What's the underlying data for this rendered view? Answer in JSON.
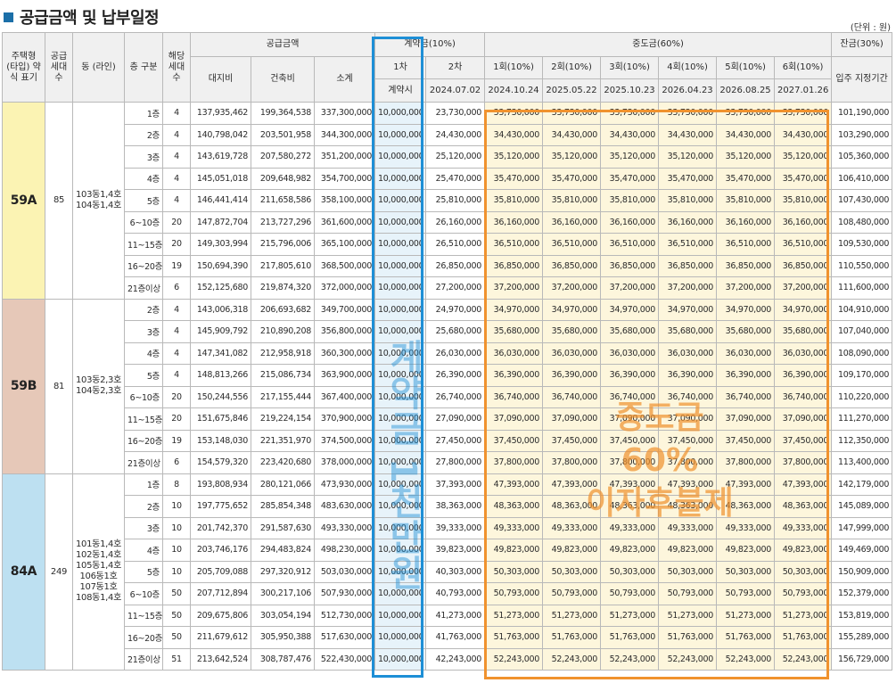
{
  "title": "공급금액 및 납부일정",
  "unit_note": "(단위 : 원)",
  "headers": {
    "type": "주택형 (타입) 약식 표기",
    "supply_units": "공급 세대 수",
    "dong": "동 (라인)",
    "floor": "층 구분",
    "households": "해당 세대 수",
    "supply_amount": "공급금액",
    "land": "대지비",
    "building": "건축비",
    "subtotal": "소계",
    "contract": "계약금(10%)",
    "first": "1차",
    "second": "2차",
    "contract_time": "계약시",
    "second_date": "2024.07.02",
    "middle": "중도금(60%)",
    "middle_items": [
      "1회(10%)",
      "2회(10%)",
      "3회(10%)",
      "4회(10%)",
      "5회(10%)",
      "6회(10%)"
    ],
    "middle_dates": [
      "2024.10.24",
      "2025.05.22",
      "2025.10.23",
      "2026.04.23",
      "2026.08.25",
      "2027.01.26"
    ],
    "balance": "잔금(30%)",
    "move_in": "입주 지정기간"
  },
  "watermarks": {
    "blue": "계약금 1천만원",
    "orange_line1": "중도금",
    "orange_line2": "60%",
    "orange_line3": "이자후불제"
  },
  "groups": [
    {
      "type": "59A",
      "supply_units": "85",
      "dong": "103동1,4호 104동1,4호",
      "rows": [
        {
          "floor": "1층",
          "hh": "4",
          "land": "137,935,462",
          "build": "199,364,538",
          "sub": "337,300,000",
          "c1": "10,000,000",
          "c2": "23,730,000",
          "m": "33,730,000",
          "bal": "101,190,000"
        },
        {
          "floor": "2층",
          "hh": "4",
          "land": "140,798,042",
          "build": "203,501,958",
          "sub": "344,300,000",
          "c1": "10,000,000",
          "c2": "24,430,000",
          "m": "34,430,000",
          "bal": "103,290,000"
        },
        {
          "floor": "3층",
          "hh": "4",
          "land": "143,619,728",
          "build": "207,580,272",
          "sub": "351,200,000",
          "c1": "10,000,000",
          "c2": "25,120,000",
          "m": "35,120,000",
          "bal": "105,360,000"
        },
        {
          "floor": "4층",
          "hh": "4",
          "land": "145,051,018",
          "build": "209,648,982",
          "sub": "354,700,000",
          "c1": "10,000,000",
          "c2": "25,470,000",
          "m": "35,470,000",
          "bal": "106,410,000"
        },
        {
          "floor": "5층",
          "hh": "4",
          "land": "146,441,414",
          "build": "211,658,586",
          "sub": "358,100,000",
          "c1": "10,000,000",
          "c2": "25,810,000",
          "m": "35,810,000",
          "bal": "107,430,000"
        },
        {
          "floor": "6~10층",
          "hh": "20",
          "land": "147,872,704",
          "build": "213,727,296",
          "sub": "361,600,000",
          "c1": "10,000,000",
          "c2": "26,160,000",
          "m": "36,160,000",
          "bal": "108,480,000"
        },
        {
          "floor": "11~15층",
          "hh": "20",
          "land": "149,303,994",
          "build": "215,796,006",
          "sub": "365,100,000",
          "c1": "10,000,000",
          "c2": "26,510,000",
          "m": "36,510,000",
          "bal": "109,530,000"
        },
        {
          "floor": "16~20층",
          "hh": "19",
          "land": "150,694,390",
          "build": "217,805,610",
          "sub": "368,500,000",
          "c1": "10,000,000",
          "c2": "26,850,000",
          "m": "36,850,000",
          "bal": "110,550,000"
        },
        {
          "floor": "21층이상",
          "hh": "6",
          "land": "152,125,680",
          "build": "219,874,320",
          "sub": "372,000,000",
          "c1": "10,000,000",
          "c2": "27,200,000",
          "m": "37,200,000",
          "bal": "111,600,000"
        }
      ]
    },
    {
      "type": "59B",
      "supply_units": "81",
      "dong": "103동2,3호 104동2,3호",
      "rows": [
        {
          "floor": "2층",
          "hh": "4",
          "land": "143,006,318",
          "build": "206,693,682",
          "sub": "349,700,000",
          "c1": "10,000,000",
          "c2": "24,970,000",
          "m": "34,970,000",
          "bal": "104,910,000"
        },
        {
          "floor": "3층",
          "hh": "4",
          "land": "145,909,792",
          "build": "210,890,208",
          "sub": "356,800,000",
          "c1": "10,000,000",
          "c2": "25,680,000",
          "m": "35,680,000",
          "bal": "107,040,000"
        },
        {
          "floor": "4층",
          "hh": "4",
          "land": "147,341,082",
          "build": "212,958,918",
          "sub": "360,300,000",
          "c1": "10,000,000",
          "c2": "26,030,000",
          "m": "36,030,000",
          "bal": "108,090,000"
        },
        {
          "floor": "5층",
          "hh": "4",
          "land": "148,813,266",
          "build": "215,086,734",
          "sub": "363,900,000",
          "c1": "10,000,000",
          "c2": "26,390,000",
          "m": "36,390,000",
          "bal": "109,170,000"
        },
        {
          "floor": "6~10층",
          "hh": "20",
          "land": "150,244,556",
          "build": "217,155,444",
          "sub": "367,400,000",
          "c1": "10,000,000",
          "c2": "26,740,000",
          "m": "36,740,000",
          "bal": "110,220,000"
        },
        {
          "floor": "11~15층",
          "hh": "20",
          "land": "151,675,846",
          "build": "219,224,154",
          "sub": "370,900,000",
          "c1": "10,000,000",
          "c2": "27,090,000",
          "m": "37,090,000",
          "bal": "111,270,000"
        },
        {
          "floor": "16~20층",
          "hh": "19",
          "land": "153,148,030",
          "build": "221,351,970",
          "sub": "374,500,000",
          "c1": "10,000,000",
          "c2": "27,450,000",
          "m": "37,450,000",
          "bal": "112,350,000"
        },
        {
          "floor": "21층이상",
          "hh": "6",
          "land": "154,579,320",
          "build": "223,420,680",
          "sub": "378,000,000",
          "c1": "10,000,000",
          "c2": "27,800,000",
          "m": "37,800,000",
          "bal": "113,400,000"
        }
      ]
    },
    {
      "type": "84A",
      "supply_units": "249",
      "dong": "101동1,4호 102동1,4호 105동1,4호 106동1호 107동1호 108동1,4호",
      "rows": [
        {
          "floor": "1층",
          "hh": "8",
          "land": "193,808,934",
          "build": "280,121,066",
          "sub": "473,930,000",
          "c1": "10,000,000",
          "c2": "37,393,000",
          "m": "47,393,000",
          "bal": "142,179,000"
        },
        {
          "floor": "2층",
          "hh": "10",
          "land": "197,775,652",
          "build": "285,854,348",
          "sub": "483,630,000",
          "c1": "10,000,000",
          "c2": "38,363,000",
          "m": "48,363,000",
          "bal": "145,089,000"
        },
        {
          "floor": "3층",
          "hh": "10",
          "land": "201,742,370",
          "build": "291,587,630",
          "sub": "493,330,000",
          "c1": "10,000,000",
          "c2": "39,333,000",
          "m": "49,333,000",
          "bal": "147,999,000"
        },
        {
          "floor": "4층",
          "hh": "10",
          "land": "203,746,176",
          "build": "294,483,824",
          "sub": "498,230,000",
          "c1": "10,000,000",
          "c2": "39,823,000",
          "m": "49,823,000",
          "bal": "149,469,000"
        },
        {
          "floor": "5층",
          "hh": "10",
          "land": "205,709,088",
          "build": "297,320,912",
          "sub": "503,030,000",
          "c1": "10,000,000",
          "c2": "40,303,000",
          "m": "50,303,000",
          "bal": "150,909,000"
        },
        {
          "floor": "6~10층",
          "hh": "50",
          "land": "207,712,894",
          "build": "300,217,106",
          "sub": "507,930,000",
          "c1": "10,000,000",
          "c2": "40,793,000",
          "m": "50,793,000",
          "bal": "152,379,000"
        },
        {
          "floor": "11~15층",
          "hh": "50",
          "land": "209,675,806",
          "build": "303,054,194",
          "sub": "512,730,000",
          "c1": "10,000,000",
          "c2": "41,273,000",
          "m": "51,273,000",
          "bal": "153,819,000"
        },
        {
          "floor": "16~20층",
          "hh": "50",
          "land": "211,679,612",
          "build": "305,950,388",
          "sub": "517,630,000",
          "c1": "10,000,000",
          "c2": "41,763,000",
          "m": "51,763,000",
          "bal": "155,289,000"
        },
        {
          "floor": "21층이상",
          "hh": "51",
          "land": "213,642,524",
          "build": "308,787,476",
          "sub": "522,430,000",
          "c1": "10,000,000",
          "c2": "42,243,000",
          "m": "52,243,000",
          "bal": "156,729,000"
        }
      ]
    }
  ]
}
